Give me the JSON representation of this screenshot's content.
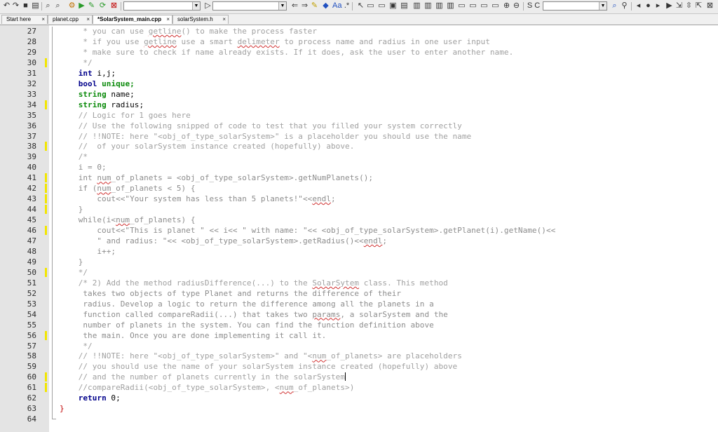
{
  "toolbar": {
    "search_value": "",
    "find_value": "",
    "status_letters": "S C"
  },
  "tabs": [
    {
      "label": "Start here",
      "active": false
    },
    {
      "label": "planet.cpp",
      "active": false
    },
    {
      "label": "*SolarSystem_main.cpp",
      "active": true
    },
    {
      "label": "solarSystem.h",
      "active": false
    }
  ],
  "tab_close_glyph": "×",
  "lines": [
    {
      "num": "27",
      "changed": false,
      "text": "     * you can use getline() to make the process faster"
    },
    {
      "num": "28",
      "changed": false,
      "text": "     * if you use getline use a smart delimeter to process name and radius in one user input"
    },
    {
      "num": "29",
      "changed": false,
      "text": "     * make sure to check if name already exists. If it does, ask the user to enter another name."
    },
    {
      "num": "30",
      "changed": true,
      "text": "     */"
    },
    {
      "num": "31",
      "changed": false,
      "text": "    int i,j;"
    },
    {
      "num": "32",
      "changed": false,
      "text": "    bool unique;"
    },
    {
      "num": "33",
      "changed": false,
      "text": "    string name;"
    },
    {
      "num": "34",
      "changed": true,
      "text": "    string radius;"
    },
    {
      "num": "35",
      "changed": false,
      "text": "    // Logic for 1 goes here"
    },
    {
      "num": "36",
      "changed": false,
      "text": "    // Use the following snipped of code to test that you filled your system correctly"
    },
    {
      "num": "37",
      "changed": false,
      "text": "    // !!NOTE: here \"<obj_of_type_solarSystem>\" is a placeholder you should use the name"
    },
    {
      "num": "38",
      "changed": true,
      "text": "    //  of your solarSystem instance created (hopefully) above."
    },
    {
      "num": "39",
      "changed": false,
      "text": "    /*"
    },
    {
      "num": "40",
      "changed": false,
      "text": "    i = 0;"
    },
    {
      "num": "41",
      "changed": true,
      "text": "    int num_of_planets = <obj_of_type_solarSystem>.getNumPlanets();"
    },
    {
      "num": "42",
      "changed": true,
      "text": "    if (num_of_planets < 5) {"
    },
    {
      "num": "43",
      "changed": true,
      "text": "        cout<<\"Your system has less than 5 planets!\"<<endl;"
    },
    {
      "num": "44",
      "changed": true,
      "text": "    }"
    },
    {
      "num": "45",
      "changed": false,
      "text": "    while(i<num_of_planets) {"
    },
    {
      "num": "46",
      "changed": true,
      "text": "        cout<<\"This is planet \" << i<< \" with name: \"<< <obj_of_type_solarSystem>.getPlanet(i).getName()<<"
    },
    {
      "num": "47",
      "changed": false,
      "text": "        \" and radius: \"<< <obj_of_type_solarSystem>.getRadius()<<endl;"
    },
    {
      "num": "48",
      "changed": false,
      "text": "        i++;"
    },
    {
      "num": "49",
      "changed": false,
      "text": "    }"
    },
    {
      "num": "50",
      "changed": true,
      "text": "    */"
    },
    {
      "num": "51",
      "changed": false,
      "text": "    /* 2) Add the method radiusDifference(...) to the SolarSytem class. This method"
    },
    {
      "num": "52",
      "changed": false,
      "text": "     takes two objects of type Planet and returns the difference of their"
    },
    {
      "num": "53",
      "changed": false,
      "text": "     radius. Develop a logic to return the difference among all the planets in a"
    },
    {
      "num": "54",
      "changed": false,
      "text": "     function called compareRadii(...) that takes two params, a solarSystem and the"
    },
    {
      "num": "55",
      "changed": false,
      "text": "     number of planets in the system. You can find the function definition above"
    },
    {
      "num": "56",
      "changed": true,
      "text": "     the main. Once you are done implementing it call it."
    },
    {
      "num": "57",
      "changed": false,
      "text": "     */"
    },
    {
      "num": "58",
      "changed": false,
      "text": "    // !!NOTE: here \"<obj_of_type_solarSystem>\" and \"<num_of_planets> are placeholders"
    },
    {
      "num": "59",
      "changed": false,
      "text": "    // you should use the name of your solarSystem instance created (hopefully) above"
    },
    {
      "num": "60",
      "changed": true,
      "text": "    // and the number of planets currently in the solarSystem"
    },
    {
      "num": "61",
      "changed": true,
      "text": "    //compareRadii(<obj_of_type_solarSystem>, <num_of_planets>)"
    },
    {
      "num": "62",
      "changed": false,
      "text": "    return 0;"
    },
    {
      "num": "63",
      "changed": false,
      "text": "}"
    },
    {
      "num": "64",
      "changed": false,
      "text": ""
    }
  ],
  "colors": {
    "comment": "#a0a0a0",
    "keyword": "#00008b",
    "type_keyword": "#0a8a0a",
    "changed_marker": "#f2e600",
    "gutter": "#e4e4e4"
  }
}
